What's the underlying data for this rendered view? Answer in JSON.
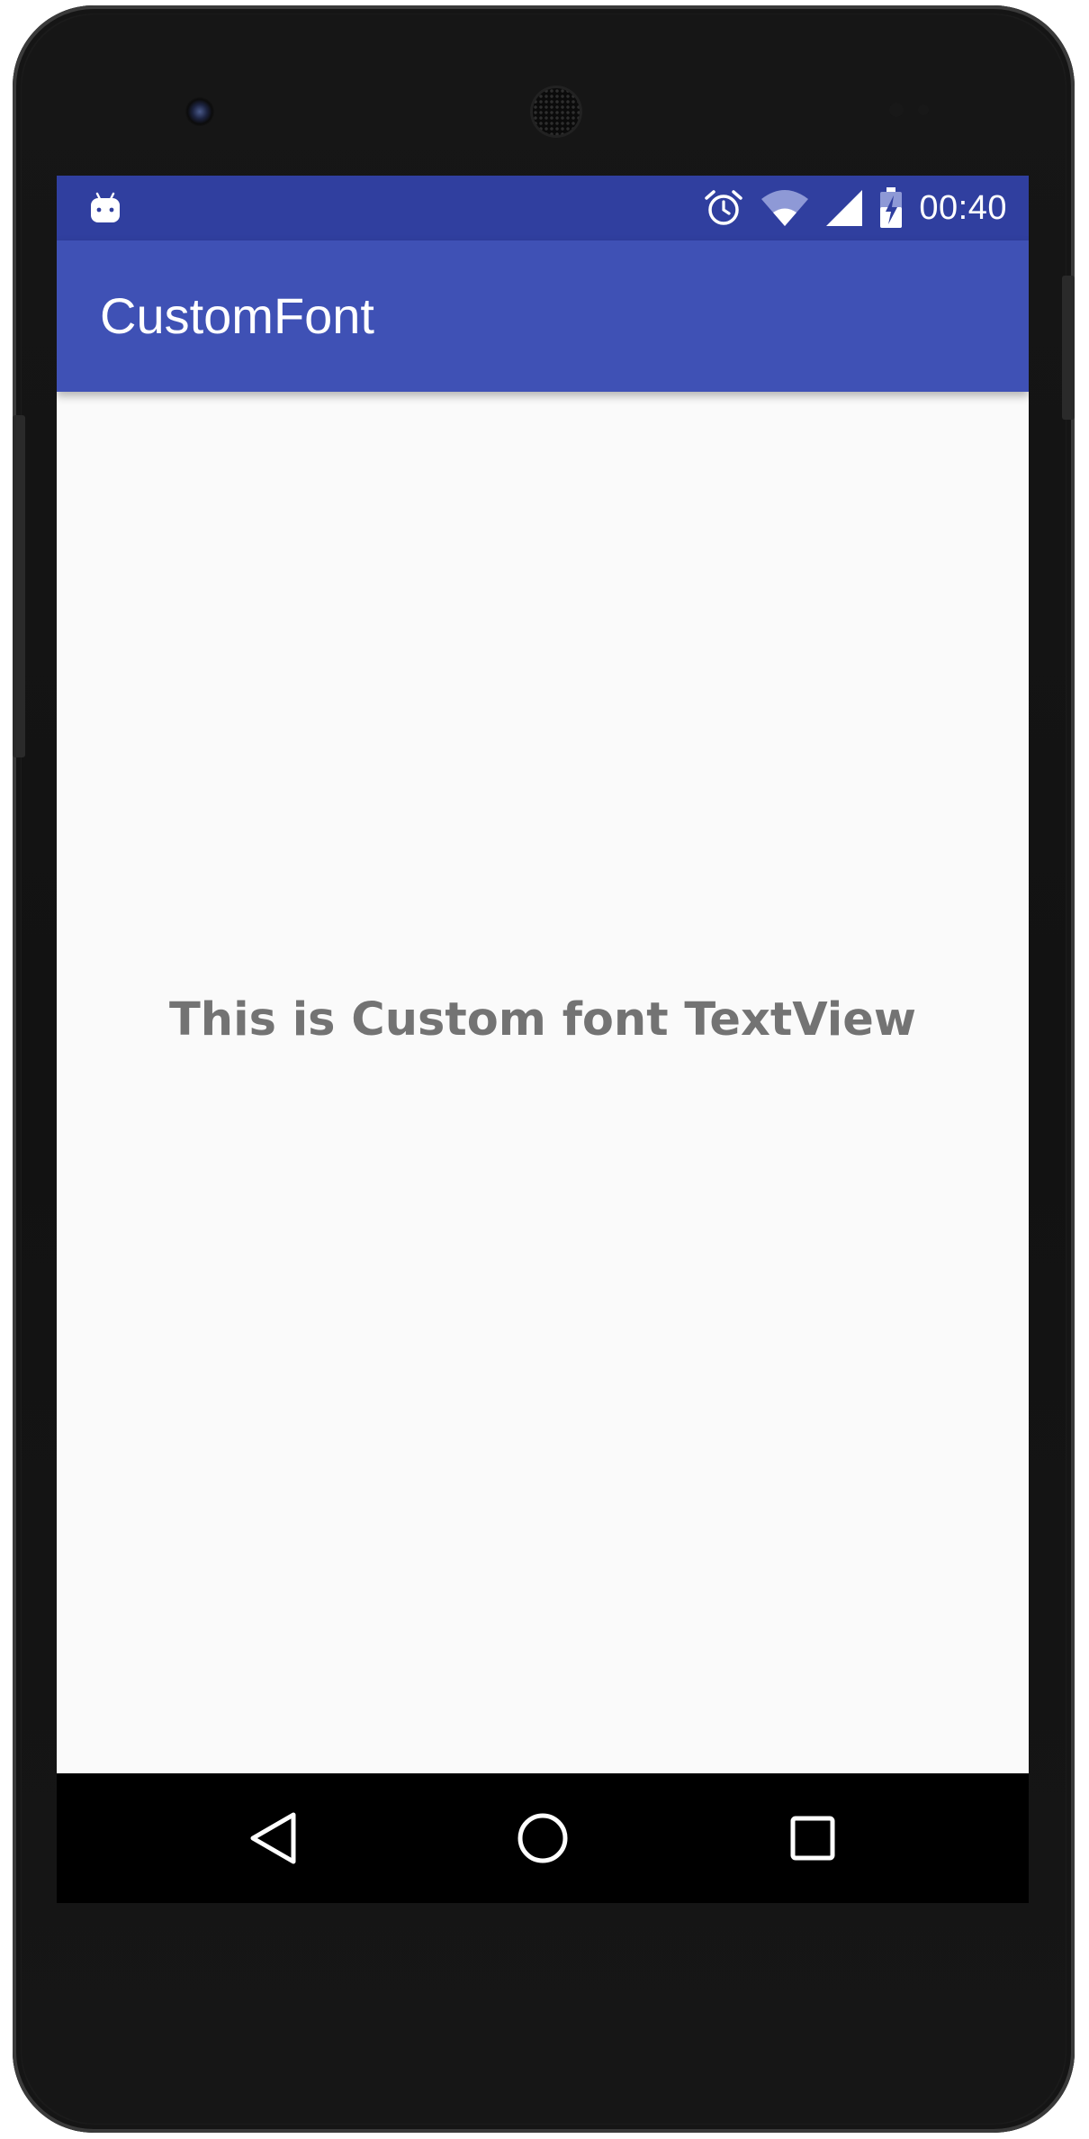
{
  "status_bar": {
    "time": "00:40",
    "icons": [
      "android-icon",
      "alarm-icon",
      "wifi-icon",
      "cell-signal-icon",
      "battery-charging-icon"
    ],
    "color": "#303f9f"
  },
  "app_bar": {
    "title": "CustomFont",
    "color": "#3f51b5"
  },
  "content": {
    "text": "This is Custom font TextView",
    "text_color": "#737373",
    "background": "#fafafa"
  },
  "nav_bar": {
    "buttons": [
      "back-icon",
      "home-icon",
      "recents-icon"
    ]
  }
}
